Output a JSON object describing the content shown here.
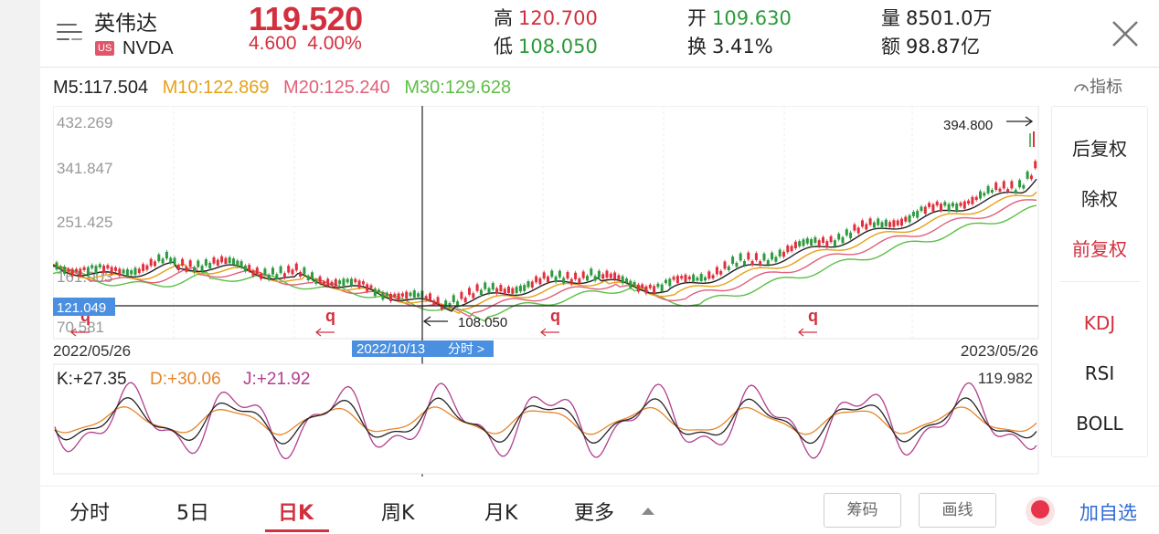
{
  "header": {
    "stock_name": "英伟达",
    "market_badge": "US",
    "ticker": "NVDA",
    "price": "119.520",
    "change_abs": "4.600",
    "change_pct": "4.00%",
    "high_label": "高",
    "high_value": "120.700",
    "low_label": "低",
    "low_value": "108.050",
    "open_label": "开",
    "open_value": "109.630",
    "turnover_label": "换",
    "turnover_value": "3.41%",
    "volume_label": "量",
    "volume_value": "8501.0万",
    "amount_label": "额",
    "amount_value": "98.87亿",
    "menu_icon": "menu-icon",
    "close_icon": "close-icon"
  },
  "ma": {
    "m5": "M5:117.504",
    "m10": "M10:122.869",
    "m20": "M20:125.240",
    "m30": "M30:129.628",
    "indicator_label": "指标",
    "colors": {
      "m5": "#222222",
      "m10": "#e6a117",
      "m20": "#e0607a",
      "m30": "#5cbf45"
    }
  },
  "price_chart": {
    "y_ticks": [
      "432.269",
      "341.847",
      "251.425",
      "161.003",
      "70.581"
    ],
    "crosshair_price": "121.049",
    "start_date": "2022/05/26",
    "end_date": "2023/05/26",
    "cursor_date": "2022/10/13",
    "cursor_link": "分时 >",
    "max_label": "394.800",
    "min_label": "108.050",
    "marker_glyph": "q"
  },
  "kdj": {
    "k": "K:+27.35",
    "d": "D:+30.06",
    "j": "J:+21.92",
    "top_value": "119.982",
    "colors": {
      "k": "#222222",
      "d": "#e6852a",
      "j": "#b13e8c"
    }
  },
  "side_menu": {
    "items": [
      "后复权",
      "除权",
      "前复权",
      "KDJ",
      "RSI",
      "BOLL"
    ],
    "active_color": "#d2303e"
  },
  "bottom": {
    "tabs": [
      "分时",
      "5日",
      "日K",
      "周K",
      "月K",
      "更多"
    ],
    "chips_label": "筹码",
    "draw_label": "画线",
    "add_watch_label": "加自选"
  }
}
